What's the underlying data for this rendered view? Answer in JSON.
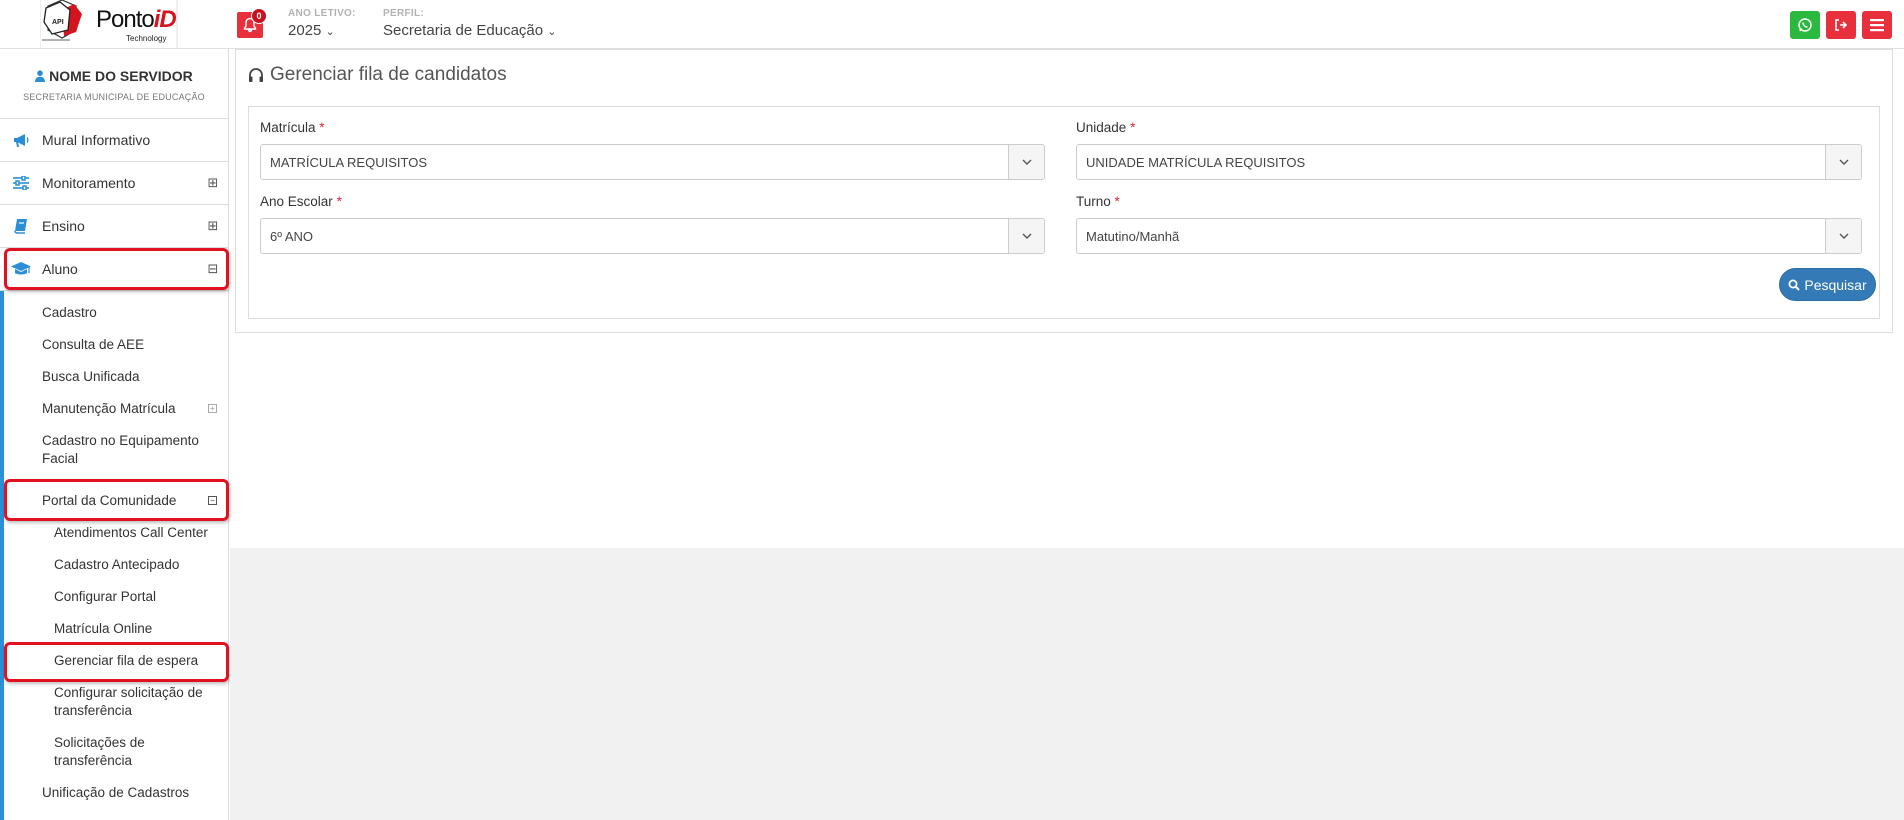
{
  "header": {
    "logo_text": "PontoiD",
    "logo_sub": "Technology",
    "notification_count": "0",
    "ano_letivo_label": "ANO LETIVO:",
    "ano_letivo_value": "2025",
    "perfil_label": "PERFIL:",
    "perfil_value": "Secretaria de Educação",
    "colors": {
      "whatsapp": "#2ab83e",
      "logout": "#e8303c",
      "menu": "#e8303c"
    }
  },
  "sidebar": {
    "user_name": "NOME DO SERVIDOR",
    "user_org": "SECRETARIA MUNICIPAL DE EDUCAÇÃO",
    "items": [
      {
        "label": "Mural Informativo",
        "icon": "megaphone-icon"
      },
      {
        "label": "Monitoramento",
        "icon": "sliders-icon",
        "toggle": "⊞"
      },
      {
        "label": "Ensino",
        "icon": "book-icon",
        "toggle": "⊞"
      },
      {
        "label": "Aluno",
        "icon": "graduation-cap-icon",
        "toggle": "⊟"
      }
    ],
    "aluno_sub": [
      {
        "label": "Cadastro"
      },
      {
        "label": "Consulta de AEE"
      },
      {
        "label": "Busca Unificada"
      },
      {
        "label": "Manutenção Matrícula"
      },
      {
        "label": "Cadastro no Equipamento Facial"
      },
      {
        "label": "Portal da Comunidade"
      },
      {
        "label": "Unificação de Cadastros"
      }
    ],
    "portal_sub": [
      {
        "label": "Atendimentos Call Center"
      },
      {
        "label": "Cadastro Antecipado"
      },
      {
        "label": "Configurar Portal"
      },
      {
        "label": "Matrícula Online"
      },
      {
        "label": "Gerenciar fila de espera"
      },
      {
        "label": "Configurar solicitação de transferência"
      },
      {
        "label": "Solicitações de transferência"
      }
    ]
  },
  "main": {
    "title": "Gerenciar fila de candidatos",
    "fields": {
      "matricula": {
        "label": "Matrícula",
        "required": "*",
        "value": "MATRÍCULA REQUISITOS"
      },
      "unidade": {
        "label": "Unidade",
        "required": "*",
        "value": "UNIDADE MATRÍCULA REQUISITOS"
      },
      "ano_escolar": {
        "label": "Ano Escolar",
        "required": "*",
        "value": "6º ANO"
      },
      "turno": {
        "label": "Turno",
        "required": "*",
        "value": "Matutino/Manhã"
      }
    },
    "search_button": "Pesquisar"
  },
  "colors": {
    "accent": "#2b8fd6",
    "highlight": "#e01222",
    "primary_button": "#337ab7"
  }
}
